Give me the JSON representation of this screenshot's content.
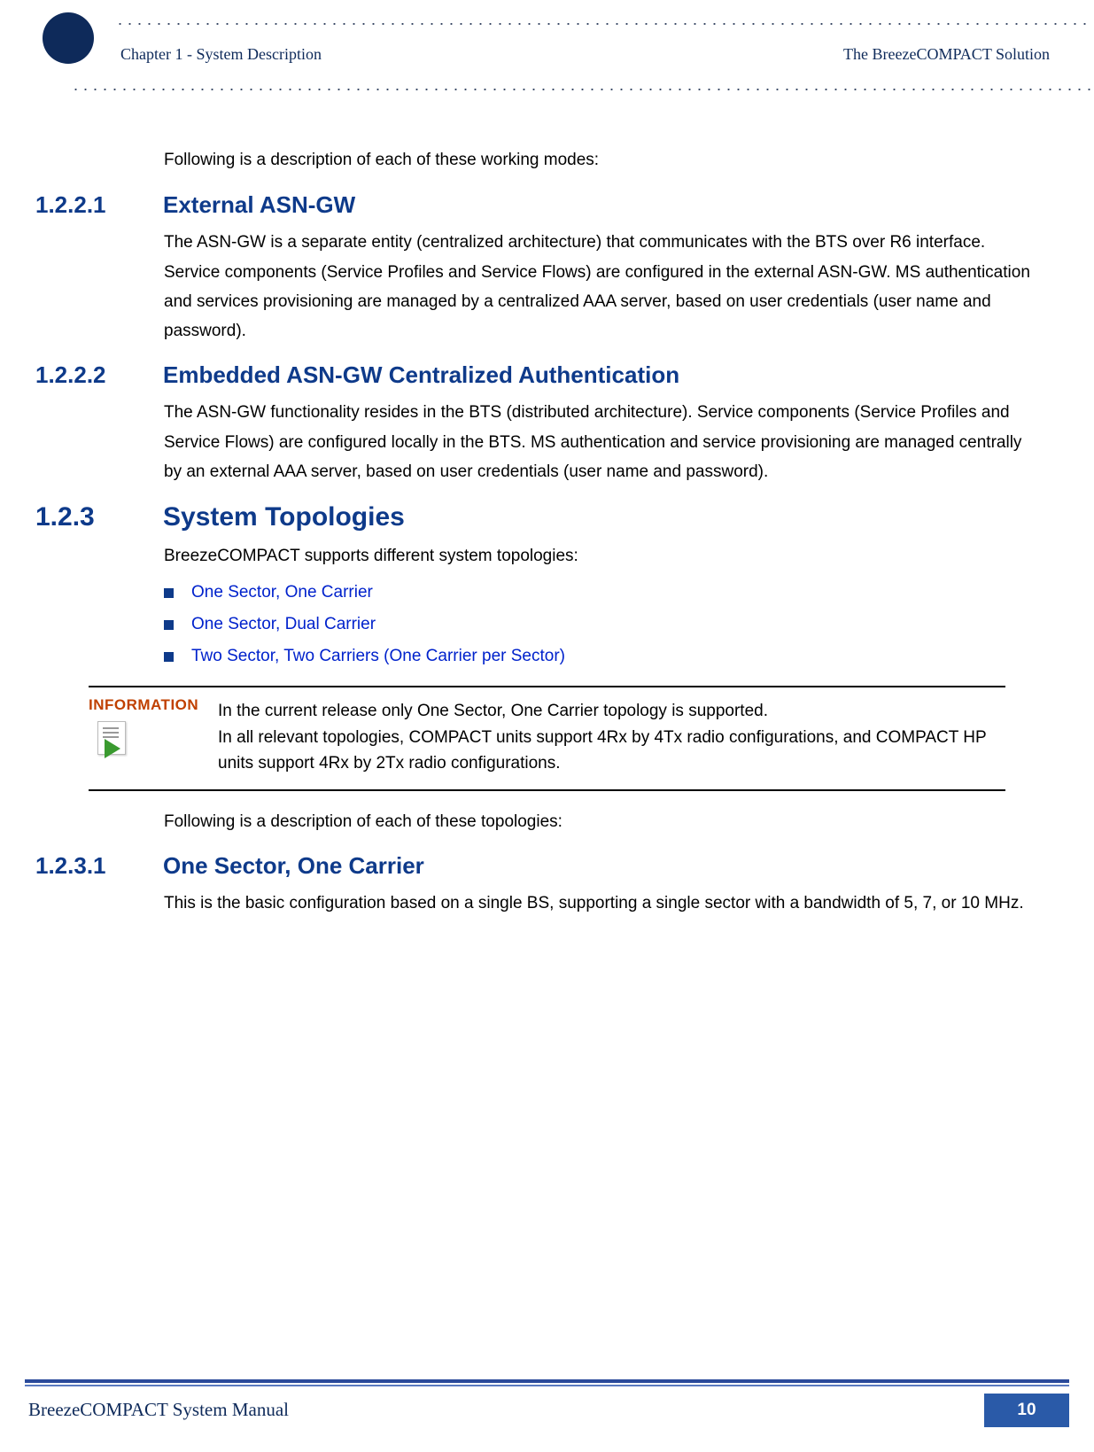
{
  "header": {
    "chapter": "Chapter 1 - System Description",
    "solution": "The BreezeCOMPACT Solution"
  },
  "intro": "Following is a description of each of these working modes:",
  "sec_1_2_2_1": {
    "num": "1.2.2.1",
    "title": "External ASN-GW",
    "body": "The ASN-GW is a separate entity (centralized architecture) that communicates with the BTS over R6 interface. Service components (Service Profiles and Service Flows) are configured in the external ASN-GW. MS authentication and services provisioning are managed by a centralized AAA server, based on user credentials (user name and password)."
  },
  "sec_1_2_2_2": {
    "num": "1.2.2.2",
    "title": "Embedded ASN-GW Centralized Authentication",
    "body": "The ASN-GW functionality resides in the BTS (distributed architecture). Service components (Service Profiles and Service Flows) are configured locally in the BTS. MS authentication and service provisioning are managed centrally by an external AAA server, based on user credentials (user name and password)."
  },
  "sec_1_2_3": {
    "num": "1.2.3",
    "title": "System Topologies",
    "intro": "BreezeCOMPACT supports different system topologies:",
    "items": [
      "One Sector, One Carrier",
      "One Sector, Dual Carrier",
      "Two Sector, Two Carriers (One Carrier per Sector)"
    ]
  },
  "info": {
    "label": "INFORMATION",
    "line1": "In the current release only One Sector, One Carrier topology is supported.",
    "line2": "In all relevant topologies, COMPACT units support 4Rx by 4Tx radio configurations, and COMPACT HP units support 4Rx by 2Tx radio configurations."
  },
  "post_info": "Following is a description of each of these topologies:",
  "sec_1_2_3_1": {
    "num": "1.2.3.1",
    "title": "One Sector, One Carrier",
    "body": "This is the basic configuration based on a single BS, supporting a single sector with a bandwidth of 5, 7, or 10 MHz."
  },
  "footer": {
    "title": "BreezeCOMPACT System Manual",
    "page": "10"
  }
}
